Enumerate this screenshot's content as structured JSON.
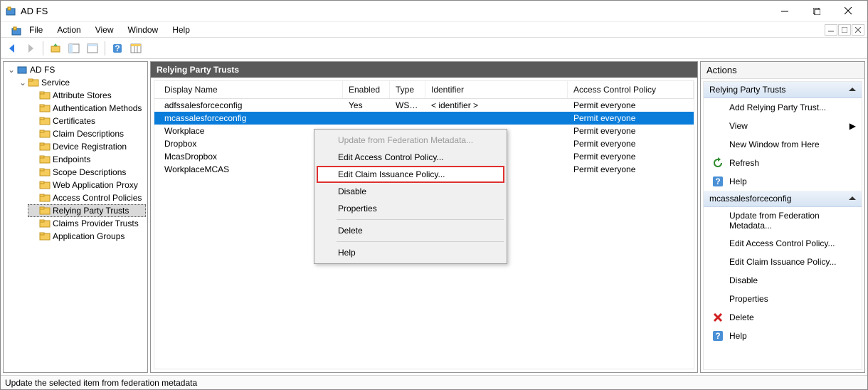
{
  "title": "AD FS",
  "menus": {
    "file": "File",
    "action": "Action",
    "view": "View",
    "window": "Window",
    "help": "Help"
  },
  "tree": {
    "root": "AD FS",
    "service": "Service",
    "children": [
      "Attribute Stores",
      "Authentication Methods",
      "Certificates",
      "Claim Descriptions",
      "Device Registration",
      "Endpoints",
      "Scope Descriptions",
      "Web Application Proxy"
    ],
    "siblings": [
      "Access Control Policies",
      "Relying Party Trusts",
      "Claims Provider Trusts",
      "Application Groups"
    ],
    "selected": "Relying Party Trusts"
  },
  "center": {
    "header": "Relying Party Trusts",
    "columns": [
      "Display Name",
      "Enabled",
      "Type",
      "Identifier",
      "Access Control Policy"
    ],
    "rows": [
      {
        "name": "adfssalesforceconfig",
        "enabled": "Yes",
        "type": "WS-T...",
        "identifier": "< identifier >",
        "policy": "Permit everyone",
        "selected": false
      },
      {
        "name": "mcassalesforceconfig",
        "enabled": "",
        "type": "",
        "identifier": "",
        "policy": "Permit everyone",
        "selected": true
      },
      {
        "name": "Workplace",
        "enabled": "",
        "type": "",
        "identifier": "",
        "policy": "Permit everyone",
        "selected": false
      },
      {
        "name": "Dropbox",
        "enabled": "",
        "type": "",
        "identifier": "",
        "policy": "Permit everyone",
        "selected": false
      },
      {
        "name": "McasDropbox",
        "enabled": "",
        "type": "",
        "identifier": "",
        "policy": "Permit everyone",
        "selected": false
      },
      {
        "name": "WorkplaceMCAS",
        "enabled": "",
        "type": "",
        "identifier": "",
        "policy": "Permit everyone",
        "selected": false
      }
    ]
  },
  "context_menu": [
    {
      "label": "Update from Federation Metadata...",
      "disabled": true
    },
    {
      "label": "Edit Access Control Policy..."
    },
    {
      "label": "Edit Claim Issuance Policy...",
      "highlight": true
    },
    {
      "label": "Disable"
    },
    {
      "label": "Properties"
    },
    {
      "sep": true
    },
    {
      "label": "Delete"
    },
    {
      "sep": true
    },
    {
      "label": "Help"
    }
  ],
  "actions": {
    "title": "Actions",
    "section1": "Relying Party Trusts",
    "items1": [
      {
        "label": "Add Relying Party Trust...",
        "icon": "none"
      },
      {
        "label": "View",
        "icon": "none",
        "arrow": true
      },
      {
        "label": "New Window from Here",
        "icon": "none"
      },
      {
        "label": "Refresh",
        "icon": "refresh"
      },
      {
        "label": "Help",
        "icon": "help"
      }
    ],
    "section2": "mcassalesforceconfig",
    "items2": [
      {
        "label": "Update from Federation Metadata...",
        "icon": "none"
      },
      {
        "label": "Edit Access Control Policy...",
        "icon": "none"
      },
      {
        "label": "Edit Claim Issuance Policy...",
        "icon": "none"
      },
      {
        "label": "Disable",
        "icon": "none"
      },
      {
        "label": "Properties",
        "icon": "none"
      },
      {
        "label": "Delete",
        "icon": "delete"
      },
      {
        "label": "Help",
        "icon": "help"
      }
    ]
  },
  "statusbar": "Update the selected item from federation metadata"
}
